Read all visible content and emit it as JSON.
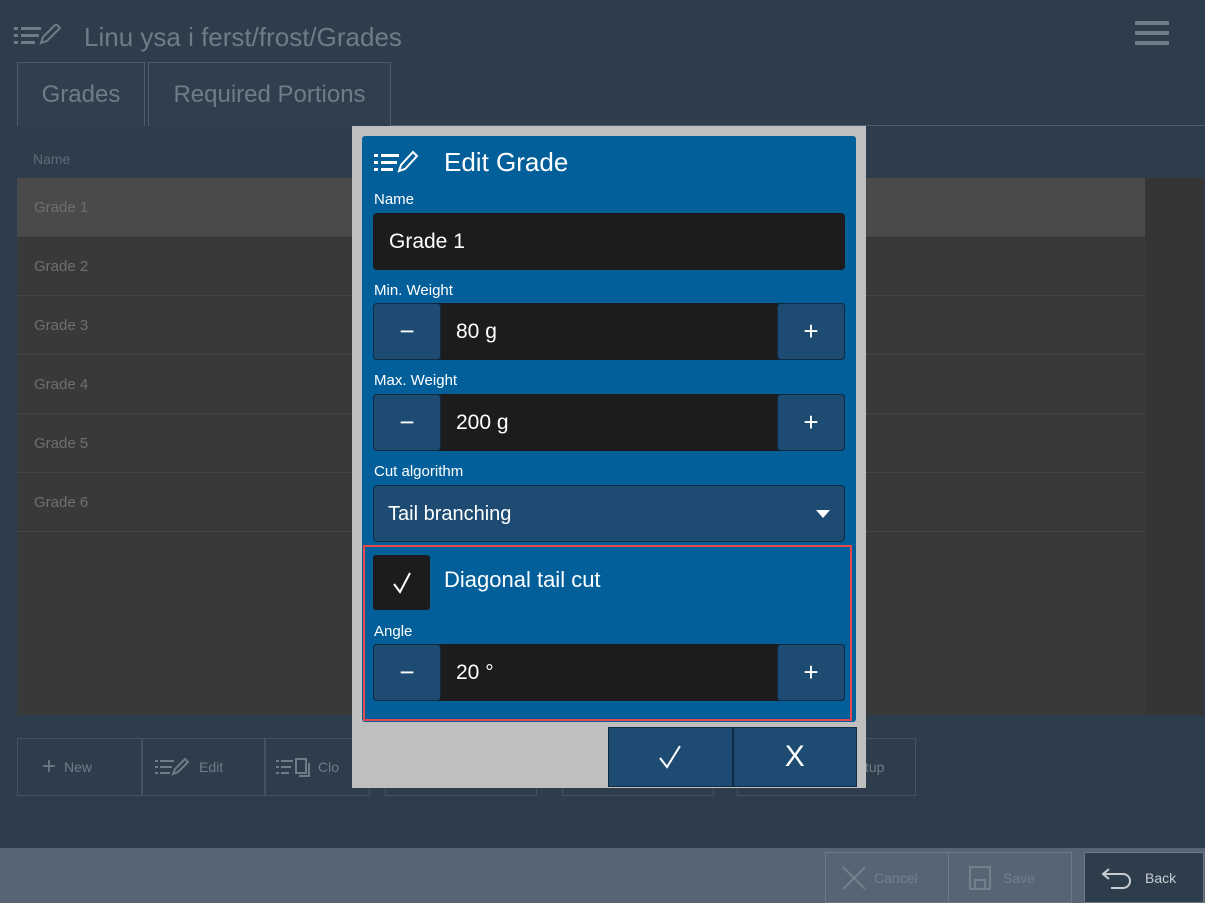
{
  "header": {
    "title": "Linu ysa i ferst/frost/Grades",
    "icon": "edit-list-icon",
    "menu_icon": "hamburger-menu-icon"
  },
  "tabs": [
    {
      "label": "Grades",
      "active": true
    },
    {
      "label": "Required Portions",
      "active": false
    }
  ],
  "grade_list": {
    "column_header": "Name",
    "rows": [
      {
        "name": "Grade 1",
        "selected": true
      },
      {
        "name": "Grade 2"
      },
      {
        "name": "Grade 3"
      },
      {
        "name": "Grade 4"
      },
      {
        "name": "Grade 5"
      },
      {
        "name": "Grade 6"
      }
    ]
  },
  "toolbar": {
    "new_label": "New",
    "edit_label": "Edit",
    "clone_label_visible": "Clo",
    "setup_label_visible": "tup"
  },
  "footer": {
    "cancel_label": "Cancel",
    "save_label": "Save",
    "back_label": "Back"
  },
  "dialog": {
    "title": "Edit Grade",
    "name_label": "Name",
    "name_value": "Grade 1",
    "min_weight_label": "Min. Weight",
    "min_weight_value": "80 g",
    "max_weight_label": "Max. Weight",
    "max_weight_value": "200 g",
    "cut_algorithm_label": "Cut algorithm",
    "cut_algorithm_value": "Tail branching",
    "diagonal_tail_cut_label": "Diagonal tail cut",
    "diagonal_tail_cut_checked": true,
    "angle_label": "Angle",
    "angle_value": "20 °",
    "ok_symbol": "✓",
    "cancel_symbol": "X",
    "stepper_minus": "−",
    "stepper_plus": "+"
  },
  "colors": {
    "background": "#2e3d4b",
    "dialog_blue": "#035f9a",
    "button_blue": "#1d4b72",
    "field_dark": "#1c1c1c",
    "highlight_red": "#e44a4a"
  }
}
